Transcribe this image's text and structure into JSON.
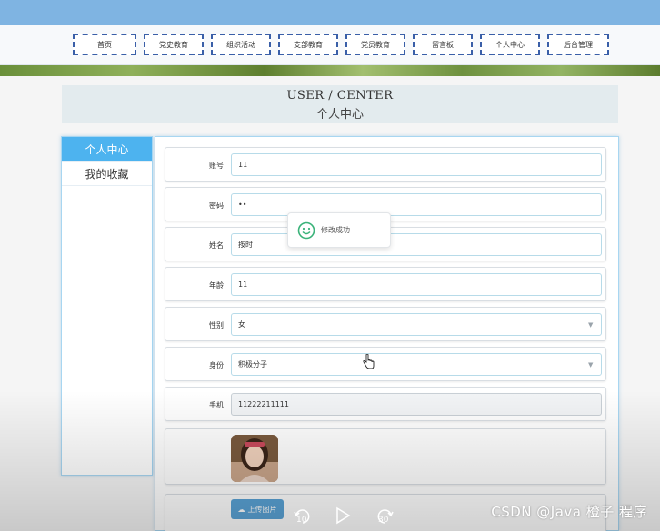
{
  "nav": {
    "items": [
      "首页",
      "党史教育",
      "组织活动",
      "支部教育",
      "党员教育",
      "留言板",
      "个人中心",
      "后台管理"
    ]
  },
  "header": {
    "title_en": "USER / CENTER",
    "title_cn": "个人中心"
  },
  "sidebar": {
    "items": [
      "个人中心",
      "我的收藏"
    ],
    "active_index": 0
  },
  "form": {
    "account": {
      "label": "账号",
      "value": "11"
    },
    "password": {
      "label": "密码",
      "value": "••"
    },
    "name": {
      "label": "姓名",
      "value": "按时"
    },
    "age": {
      "label": "年龄",
      "value": "11"
    },
    "gender": {
      "label": "性别",
      "value": "女"
    },
    "identity": {
      "label": "身份",
      "value": "积极分子"
    },
    "phone": {
      "label": "手机",
      "value": "11222211111"
    },
    "upload_label": "上传图片"
  },
  "toast": {
    "message": "修改成功",
    "icon": "smile-icon"
  },
  "video": {
    "rewind_seconds": "10",
    "forward_seconds": "30"
  },
  "watermark": "CSDN @Java  橙子  程序",
  "colors": {
    "nav_border": "#3a5fa8",
    "sidebar_active": "#4db3ef",
    "field_border": "#b7dbe9",
    "toast_icon": "#3bb37a",
    "upload_button": "#5aa3d6",
    "sky": "#7fb4e2"
  }
}
